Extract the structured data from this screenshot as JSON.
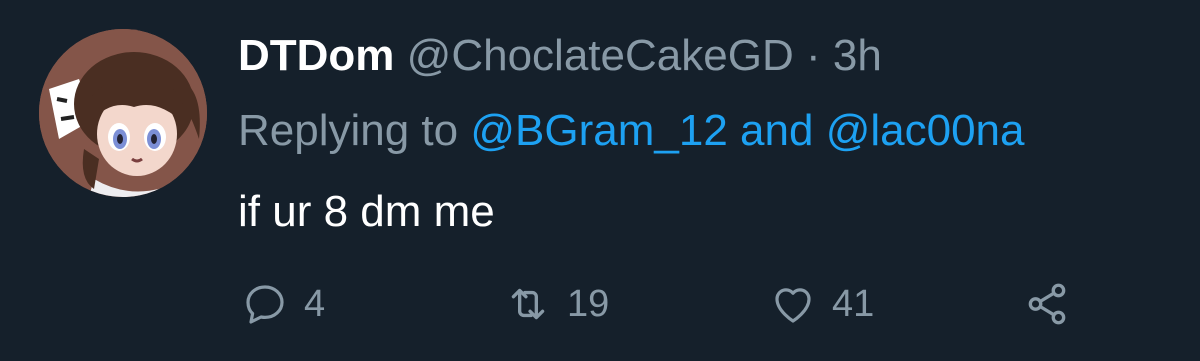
{
  "tweet": {
    "display_name": "DTDom",
    "handle": "@ChoclateCakeGD",
    "separator": "·",
    "time": "3h",
    "reply_prefix": "Replying to",
    "mention_1": "@BGram_12",
    "reply_conjunction": "and",
    "mention_2": "@lac00na",
    "text": "if ur 8 dm me"
  },
  "actions": {
    "reply_count": "4",
    "retweet_count": "19",
    "like_count": "41"
  },
  "icons": {
    "reply": "reply-icon",
    "retweet": "retweet-icon",
    "like": "heart-icon",
    "share": "share-icon"
  },
  "colors": {
    "background": "#15202b",
    "primary_text": "#ffffff",
    "secondary_text": "#8899a6",
    "link": "#1da1f2"
  }
}
